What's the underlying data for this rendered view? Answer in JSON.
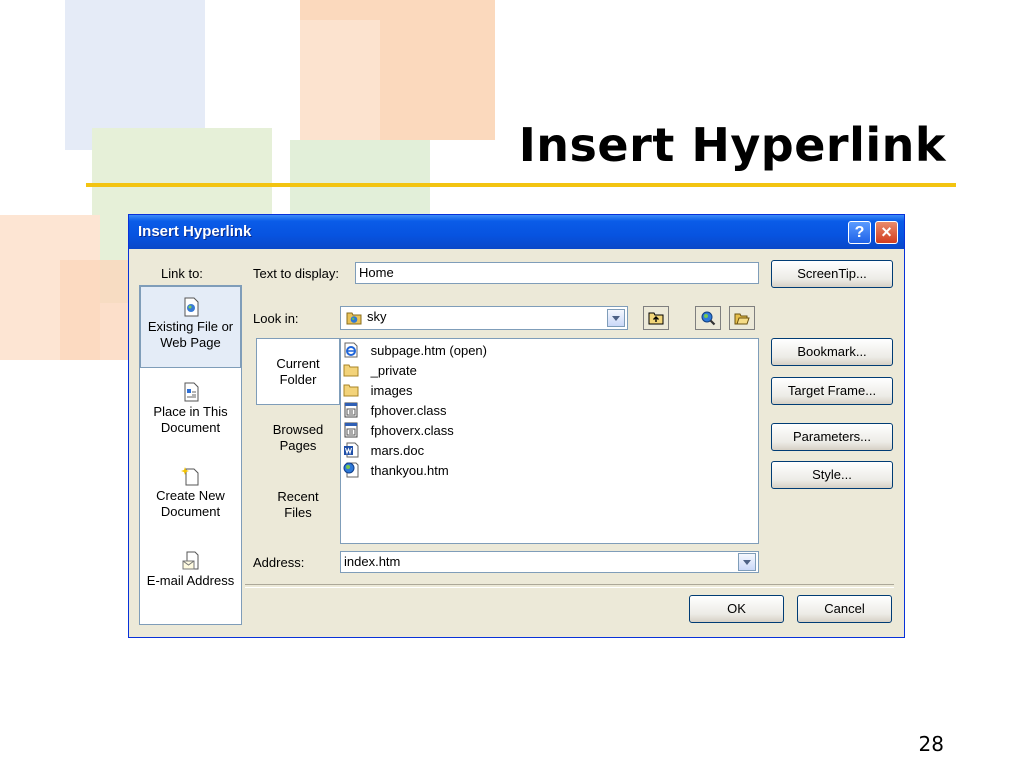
{
  "slide": {
    "title": "Insert Hyperlink",
    "page_number": "28"
  },
  "dialog": {
    "title": "Insert Hyperlink",
    "help_label": "?",
    "close_label": "×",
    "link_to_label": "Link to:",
    "link_to_items": [
      {
        "label_line1": "Existing File or",
        "label_line2": "Web Page",
        "selected": true
      },
      {
        "label_line1": "Place in This",
        "label_line2": "Document",
        "selected": false
      },
      {
        "label_line1": "Create New",
        "label_line2": "Document",
        "selected": false
      },
      {
        "label_line1": "E-mail Address",
        "label_line2": "",
        "selected": false
      }
    ],
    "text_to_display_label": "Text to display:",
    "text_to_display_value": "Home",
    "screentip_label": "ScreenTip...",
    "look_in_label": "Look in:",
    "look_in_value": "sky",
    "places": [
      {
        "line1": "Current",
        "line2": "Folder",
        "selected": true
      },
      {
        "line1": "Browsed",
        "line2": "Pages",
        "selected": false
      },
      {
        "line1": "Recent",
        "line2": "Files",
        "selected": false
      }
    ],
    "files": [
      {
        "name": "subpage.htm (open)",
        "icon": "ie-page-icon"
      },
      {
        "name": "_private",
        "icon": "folder-icon"
      },
      {
        "name": "images",
        "icon": "folder-icon"
      },
      {
        "name": "fphover.class",
        "icon": "class-file-icon"
      },
      {
        "name": "fphoverx.class",
        "icon": "class-file-icon"
      },
      {
        "name": "mars.doc",
        "icon": "word-doc-icon"
      },
      {
        "name": "thankyou.htm",
        "icon": "web-page-icon"
      }
    ],
    "bookmark_label": "Bookmark...",
    "target_frame_label": "Target Frame...",
    "parameters_label": "Parameters...",
    "style_label": "Style...",
    "address_label": "Address:",
    "address_value": "index.htm",
    "ok_label": "OK",
    "cancel_label": "Cancel"
  }
}
